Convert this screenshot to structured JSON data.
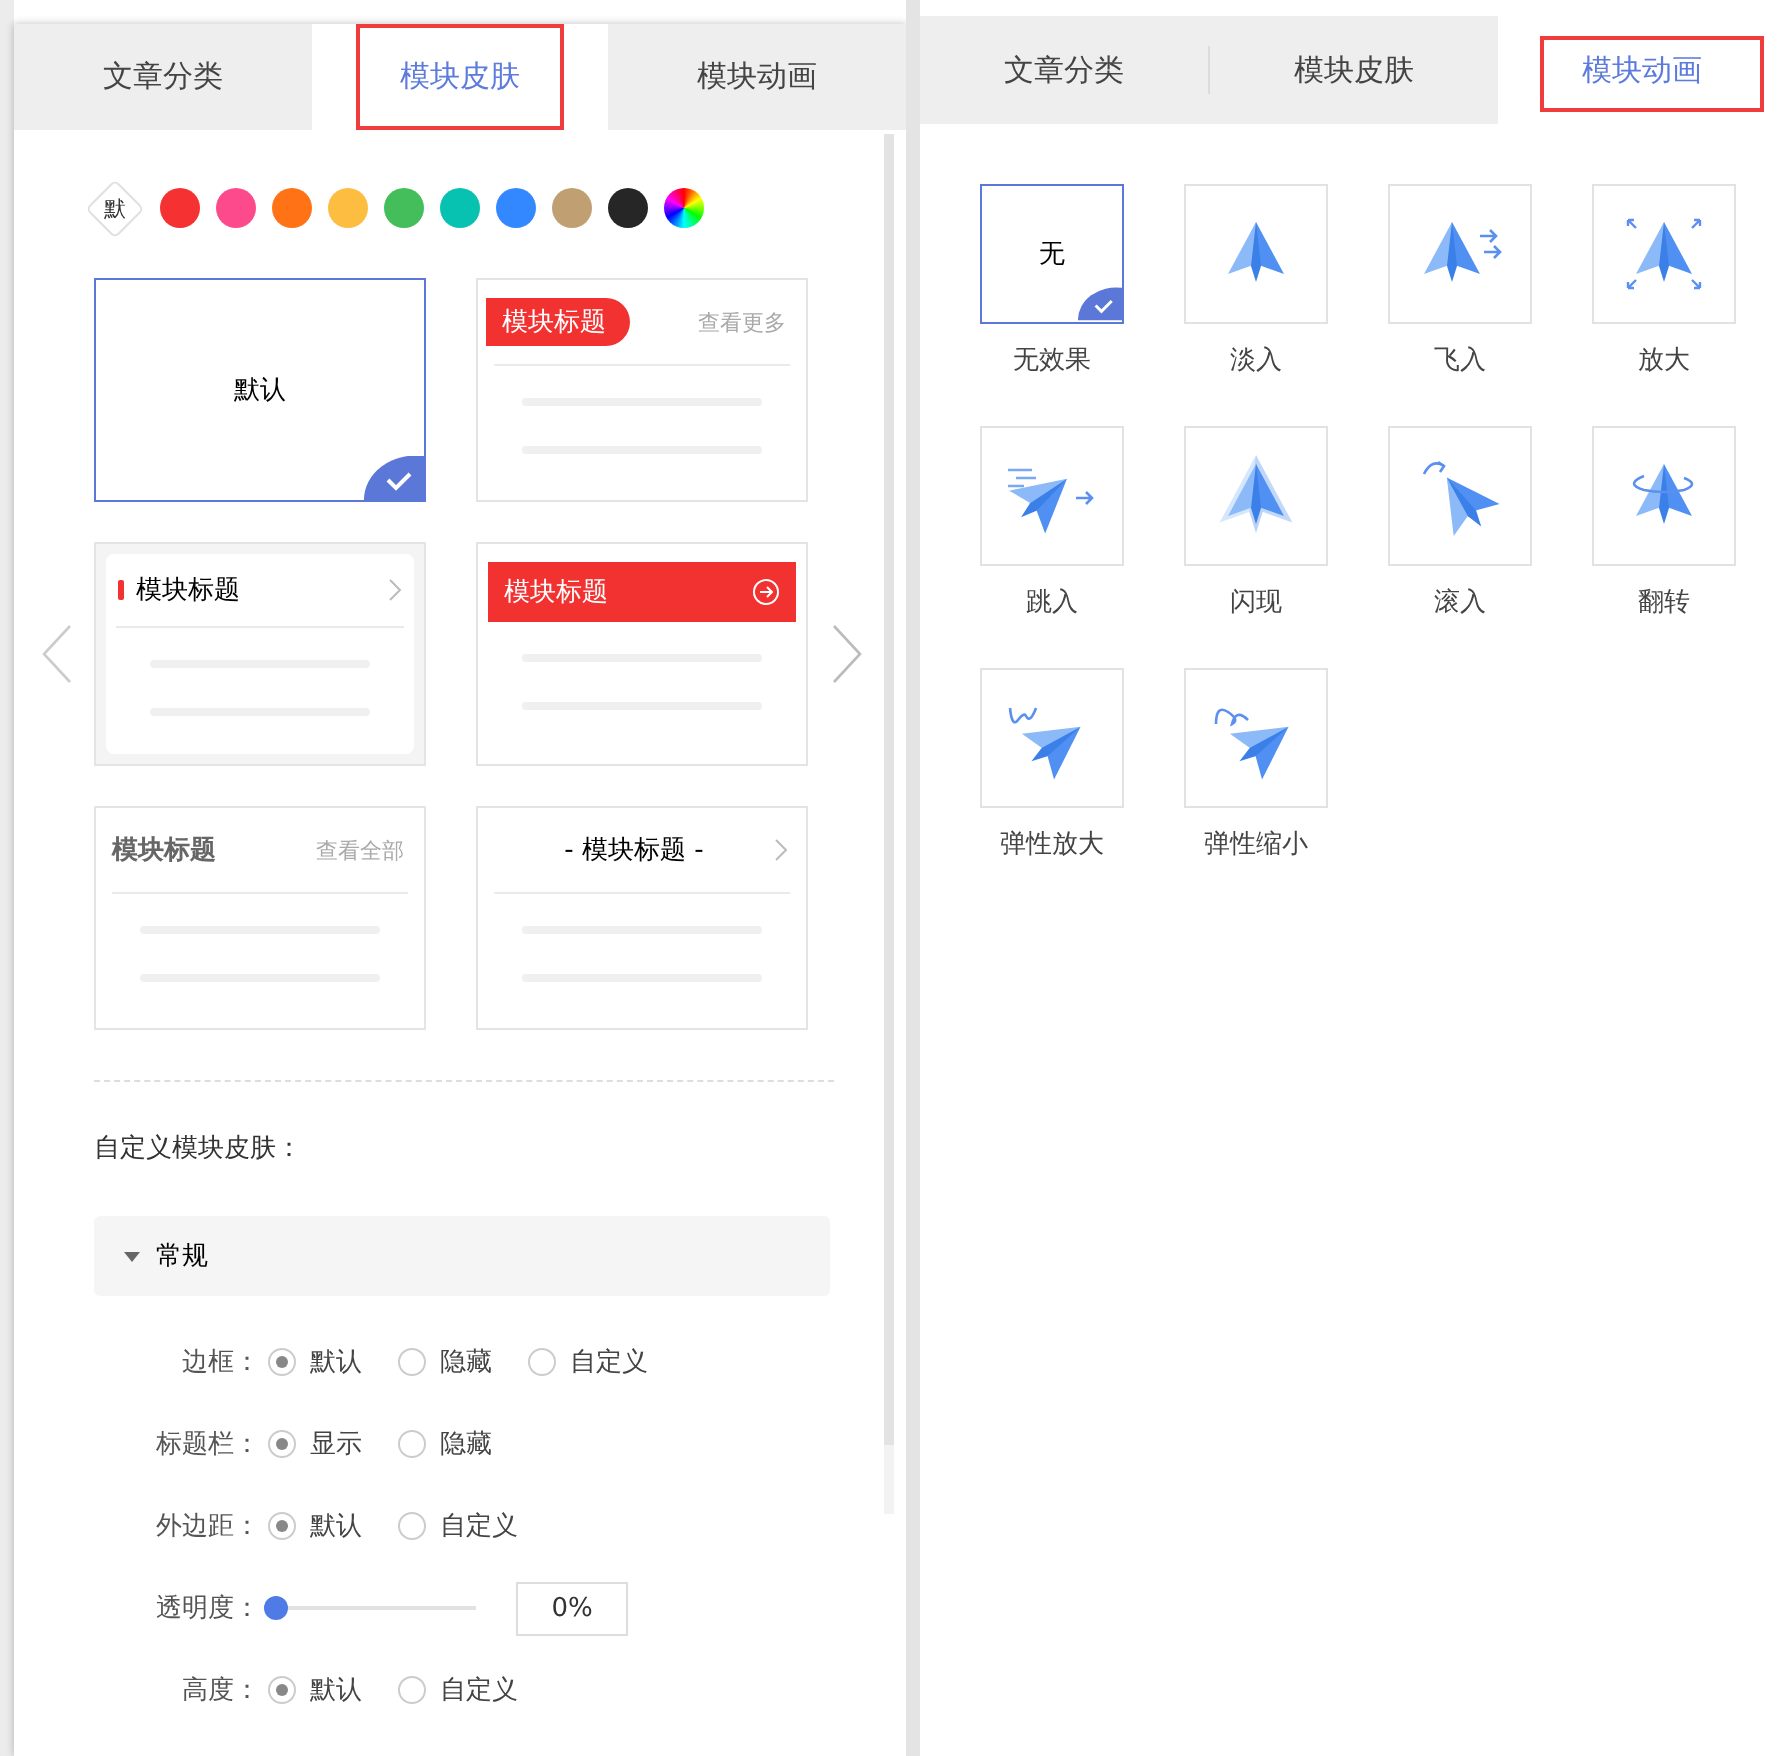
{
  "skin_panel": {
    "tabs": [
      {
        "label": "文章分类",
        "selected": false,
        "highlighted": false
      },
      {
        "label": "模块皮肤",
        "selected": true,
        "highlighted": true
      },
      {
        "label": "模块动画",
        "selected": false,
        "highlighted": false
      }
    ],
    "swatches": [
      {
        "kind": "default",
        "label": "默"
      },
      {
        "kind": "color",
        "color": "#f53131"
      },
      {
        "kind": "color",
        "color": "#fd4a8c"
      },
      {
        "kind": "color",
        "color": "#ff7316"
      },
      {
        "kind": "color",
        "color": "#fcbd40"
      },
      {
        "kind": "color",
        "color": "#43be5a"
      },
      {
        "kind": "color",
        "color": "#07c2b1"
      },
      {
        "kind": "color",
        "color": "#3388ff"
      },
      {
        "kind": "color",
        "color": "#c0a073"
      },
      {
        "kind": "color",
        "color": "#262626"
      },
      {
        "kind": "rainbow"
      }
    ],
    "skins": [
      {
        "kind": "plain",
        "title": "默认",
        "selected": true
      },
      {
        "kind": "pill",
        "title": "模块标题",
        "more": "查看更多",
        "selected": false
      },
      {
        "kind": "bar",
        "title": "模块标题",
        "selected": false
      },
      {
        "kind": "banner",
        "title": "模块标题",
        "selected": false
      },
      {
        "kind": "more",
        "title": "模块标题",
        "more": "查看全部",
        "selected": false
      },
      {
        "kind": "centered",
        "title": "- 模块标题 -",
        "selected": false
      }
    ],
    "custom_label": "自定义模块皮肤：",
    "section": {
      "title": "常规",
      "expanded": true
    },
    "settings": [
      {
        "kind": "radio",
        "label": "边框：",
        "options": [
          {
            "label": "默认",
            "selected": true
          },
          {
            "label": "隐藏",
            "selected": false
          },
          {
            "label": "自定义",
            "selected": false
          }
        ]
      },
      {
        "kind": "radio",
        "label": "标题栏：",
        "options": [
          {
            "label": "显示",
            "selected": true
          },
          {
            "label": "隐藏",
            "selected": false
          }
        ]
      },
      {
        "kind": "radio",
        "label": "外边距：",
        "options": [
          {
            "label": "默认",
            "selected": true
          },
          {
            "label": "自定义",
            "selected": false
          }
        ]
      },
      {
        "kind": "slider",
        "label": "透明度：",
        "level": 0,
        "value": "0%"
      },
      {
        "kind": "radio",
        "label": "高度：",
        "options": [
          {
            "label": "默认",
            "selected": true
          },
          {
            "label": "自定义",
            "selected": false
          }
        ]
      }
    ]
  },
  "animation_panel": {
    "tabs": [
      {
        "label": "文章分类",
        "selected": false,
        "highlighted": false
      },
      {
        "label": "模块皮肤",
        "selected": false,
        "highlighted": false
      },
      {
        "label": "模块动画",
        "selected": true,
        "highlighted": true
      }
    ],
    "animations": [
      {
        "kind": "none",
        "icon_text": "无",
        "label": "无效果",
        "selected": true
      },
      {
        "kind": "fade",
        "label": "淡入",
        "selected": false
      },
      {
        "kind": "fly",
        "label": "飞入",
        "selected": false
      },
      {
        "kind": "zoom",
        "label": "放大",
        "selected": false
      },
      {
        "kind": "jump",
        "label": "跳入",
        "selected": false
      },
      {
        "kind": "flash",
        "label": "闪现",
        "selected": false
      },
      {
        "kind": "roll",
        "label": "滚入",
        "selected": false
      },
      {
        "kind": "flip",
        "label": "翻转",
        "selected": false
      },
      {
        "kind": "elastic-zoom",
        "label": "弹性放大",
        "selected": false
      },
      {
        "kind": "elastic-shrink",
        "label": "弹性缩小",
        "selected": false
      }
    ]
  }
}
